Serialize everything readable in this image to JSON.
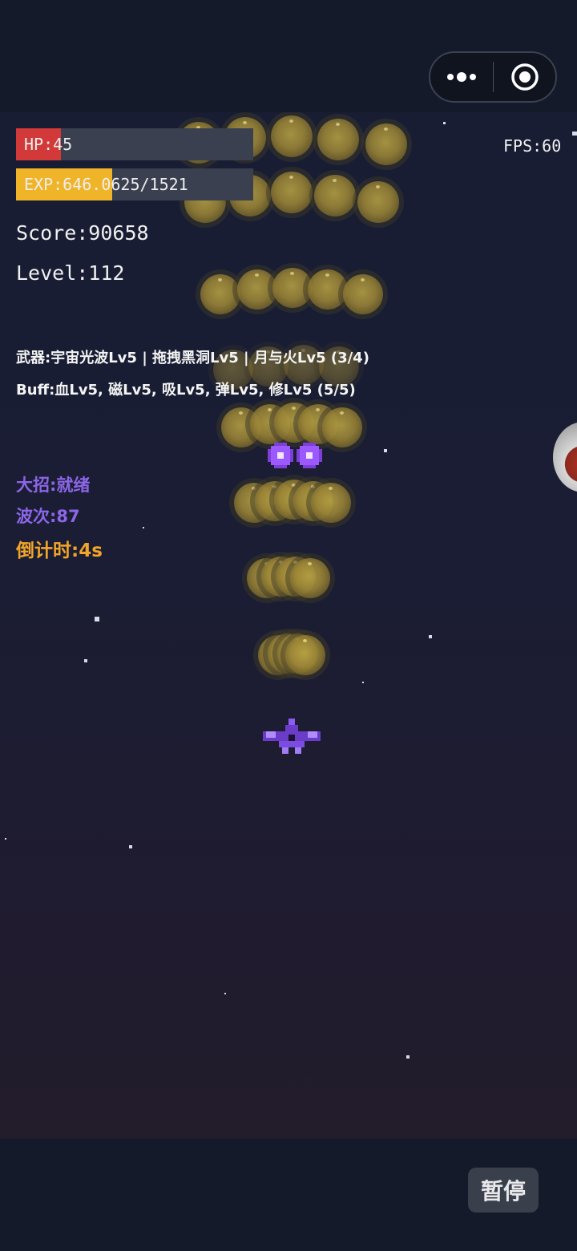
{
  "capsule": {
    "more_icon": "more-dots-icon",
    "close_icon": "target-circle-icon"
  },
  "hud": {
    "hp_label": "HP:45",
    "hp_fraction": 0.19,
    "exp_label": "EXP:646.0625/1521",
    "exp_fraction": 0.405,
    "fps": "FPS:60",
    "score": "Score:90658",
    "level": "Level:112",
    "weapons": "武器:宇宙光波Lv5 | 拖拽黑洞Lv5 | 月与火Lv5 (3/4)",
    "buffs": "Buff:血Lv5, 磁Lv5, 吸Lv5, 弹Lv5, 修Lv5 (5/5)",
    "ultimate": "大招:就绪",
    "wave": "波次:87",
    "countdown": "倒计时:4s"
  },
  "controls": {
    "pause_label": "暂停"
  },
  "colors": {
    "hp_fill": "#d23a3a",
    "exp_fill": "#f0b429",
    "bar_bg": "#3a4050",
    "ultimate_text": "#8c66e8",
    "countdown_text": "#f2a52a",
    "player_ship": "#7b4ce0",
    "projectile": "#9b59ff",
    "orb": "#a08a3a"
  }
}
